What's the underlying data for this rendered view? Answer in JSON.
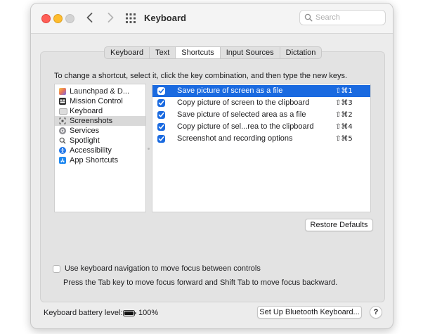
{
  "window": {
    "title": "Keyboard"
  },
  "search": {
    "placeholder": "Search",
    "value": ""
  },
  "tabs": [
    {
      "label": "Keyboard",
      "active": false
    },
    {
      "label": "Text",
      "active": false
    },
    {
      "label": "Shortcuts",
      "active": true
    },
    {
      "label": "Input Sources",
      "active": false
    },
    {
      "label": "Dictation",
      "active": false
    }
  ],
  "instructions": "To change a shortcut, select it, click the key combination, and then type the new keys.",
  "categories": [
    {
      "label": "Launchpad & D...",
      "icon": "launchpad-icon",
      "selected": false
    },
    {
      "label": "Mission Control",
      "icon": "mission-control-icon",
      "selected": false
    },
    {
      "label": "Keyboard",
      "icon": "keyboard-icon",
      "selected": false
    },
    {
      "label": "Screenshots",
      "icon": "screenshot-icon",
      "selected": true
    },
    {
      "label": "Services",
      "icon": "services-gear-icon",
      "selected": false
    },
    {
      "label": "Spotlight",
      "icon": "spotlight-icon",
      "selected": false
    },
    {
      "label": "Accessibility",
      "icon": "accessibility-icon",
      "selected": false
    },
    {
      "label": "App Shortcuts",
      "icon": "app-store-icon",
      "selected": false
    }
  ],
  "shortcuts": [
    {
      "label": "Save picture of screen as a file",
      "keys": "⇧⌘1",
      "checked": true,
      "selected": true
    },
    {
      "label": "Copy picture of screen to the clipboard",
      "keys": "⇧⌘3",
      "checked": true,
      "selected": false
    },
    {
      "label": "Save picture of selected area as a file",
      "keys": "⇧⌘2",
      "checked": true,
      "selected": false
    },
    {
      "label": "Copy picture of sel...rea to the clipboard",
      "keys": "⇧⌘4",
      "checked": true,
      "selected": false
    },
    {
      "label": "Screenshot and recording options",
      "keys": "⇧⌘5",
      "checked": true,
      "selected": false
    }
  ],
  "buttons": {
    "restore_defaults": "Restore Defaults",
    "bluetooth": "Set Up Bluetooth Keyboard...",
    "help": "?"
  },
  "keyboard_navigation": {
    "label": "Use keyboard navigation to move focus between controls",
    "description": "Press the Tab key to move focus forward and Shift Tab to move focus backward.",
    "checked": false
  },
  "battery": {
    "label": "Keyboard battery level:",
    "percent": "100%",
    "level": 1.0
  },
  "colors": {
    "accent": "#1a6ae0",
    "close": "#ff5f57",
    "minimize": "#febc2e"
  }
}
